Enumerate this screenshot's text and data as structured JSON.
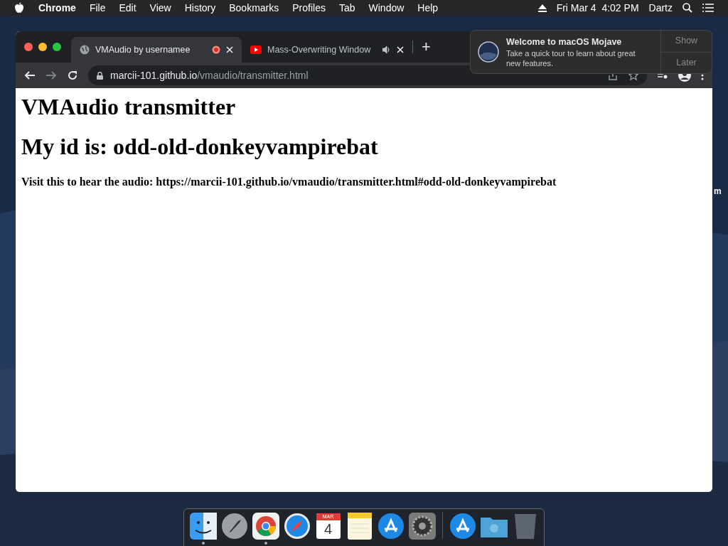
{
  "menu_bar": {
    "app": "Chrome",
    "items": [
      "File",
      "Edit",
      "View",
      "History",
      "Bookmarks",
      "Profiles",
      "Tab",
      "Window",
      "Help"
    ],
    "clock": "Fri Mar 4  4:02 PM",
    "user": "Dartz"
  },
  "desktop": {
    "label": "m"
  },
  "browser": {
    "tabs": [
      {
        "title": "VMAudio by usernamee",
        "selected": true,
        "kind": "globe",
        "recording": true,
        "audio": false
      },
      {
        "title": "Mass-Overwriting Window",
        "selected": false,
        "kind": "video",
        "recording": false,
        "audio": true
      }
    ],
    "new_tab": "+",
    "address": {
      "domain": "marcii-101.github.io",
      "path": "/vmaudio/transmitter.html"
    }
  },
  "page": {
    "heading": "VMAudio transmitter",
    "subheading": "My id is: odd-old-donkeyvampirebat",
    "text": "Visit this to hear the audio: https://marcii-101.github.io/vmaudio/transmitter.html#odd-old-donkeyvampirebat"
  },
  "notification": {
    "title": "Welcome to macOS Mojave",
    "body": "Take a quick tour to learn about great new features.",
    "actions": [
      "Show",
      "Later"
    ]
  },
  "dock": [
    {
      "kind": "finder",
      "running": true
    },
    {
      "kind": "launchpad",
      "running": false
    },
    {
      "kind": "chrome",
      "running": true
    },
    {
      "kind": "safari",
      "running": false
    },
    {
      "kind": "calendar",
      "running": false,
      "month": "MAR",
      "day": "4"
    },
    {
      "kind": "notes",
      "running": false
    },
    {
      "kind": "appstore",
      "running": false
    },
    {
      "kind": "preferences",
      "running": false
    },
    {
      "kind": "separator"
    },
    {
      "kind": "appstore",
      "running": false
    },
    {
      "kind": "folder",
      "running": false
    },
    {
      "kind": "trash",
      "running": false
    }
  ]
}
